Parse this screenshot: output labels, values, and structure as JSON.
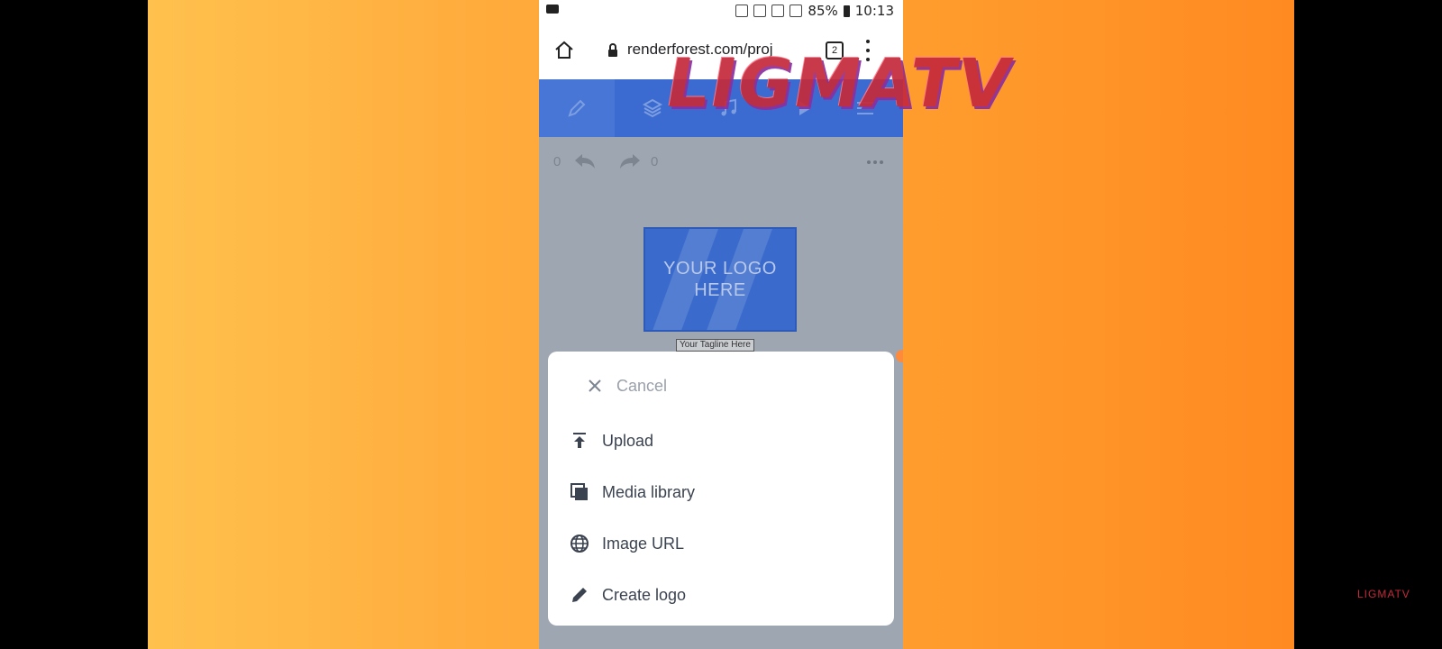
{
  "status_bar": {
    "battery": "85%",
    "time": "10:13"
  },
  "browser": {
    "url": "renderforest.com/proj",
    "tab_count": "2"
  },
  "toolbar": {
    "items": [
      {
        "icon": "pencil-icon"
      },
      {
        "icon": "layers-icon"
      },
      {
        "icon": "music-icon"
      },
      {
        "icon": "play-icon"
      },
      {
        "icon": "hamburger-menu-icon"
      }
    ]
  },
  "edit_bar": {
    "undo_count": "0",
    "redo_count": "0"
  },
  "canvas": {
    "logo_line1": "YOUR LOGO",
    "logo_line2": "HERE",
    "tagline": "Your Tagline Here"
  },
  "sheet": {
    "cancel_label": "Cancel",
    "options": [
      {
        "label": "Upload",
        "icon": "upload-icon"
      },
      {
        "label": "Media library",
        "icon": "media-library-icon"
      },
      {
        "label": "Image URL",
        "icon": "globe-icon"
      },
      {
        "label": "Create logo",
        "icon": "pencil-icon"
      }
    ]
  },
  "watermark": {
    "text": "LIGMATV",
    "small_text": "LIGMATV"
  },
  "colors": {
    "toolbar_blue": "#3b6bd0",
    "watermark_red": "#c42a3a",
    "background_orange": "#ffab3c"
  }
}
